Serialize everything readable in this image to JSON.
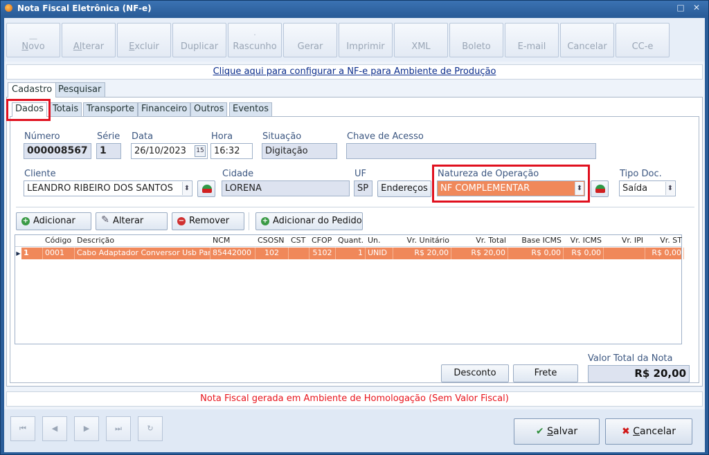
{
  "window": {
    "title": "Nota Fiscal Eletrônica (NF-e)",
    "controls": "□ ✕"
  },
  "toolbar": [
    {
      "first": "N",
      "rest": "ovo",
      "glyph": "__"
    },
    {
      "first": "Al",
      "rest": "terar",
      "glyph": ""
    },
    {
      "first": "E",
      "rest": "xcluir",
      "glyph": ""
    },
    {
      "first": "",
      "rest": "Duplicar",
      "glyph": ""
    },
    {
      "first": "",
      "rest": "Rascunho",
      "glyph": "·"
    },
    {
      "first": "",
      "rest": "Gerar",
      "glyph": ""
    },
    {
      "first": "",
      "rest": "Imprimir",
      "glyph": ""
    },
    {
      "first": "",
      "rest": "XML",
      "glyph": ""
    },
    {
      "first": "",
      "rest": "Boleto",
      "glyph": ""
    },
    {
      "first": "",
      "rest": "E-mail",
      "glyph": ""
    },
    {
      "first": "",
      "rest": "Cancelar",
      "glyph": ""
    },
    {
      "first": "",
      "rest": "CC-e",
      "glyph": ""
    }
  ],
  "prod_link": "Clique aqui para configurar a NF-e para Ambiente de Produção",
  "main_tabs": [
    "Cadastro",
    "Pesquisar"
  ],
  "sub_tabs": [
    "Dados",
    "Totais",
    "Transporte",
    "Financeiro",
    "Outros",
    "Eventos"
  ],
  "labels": {
    "numero": "Número",
    "serie": "Série",
    "data": "Data",
    "hora": "Hora",
    "situacao": "Situação",
    "chave": "Chave de Acesso",
    "cliente": "Cliente",
    "cidade": "Cidade",
    "uf": "UF",
    "natureza": "Natureza de Operação",
    "tipo": "Tipo Doc."
  },
  "values": {
    "numero": "000008567",
    "serie": "1",
    "data": "26/10/2023",
    "hora": "16:32",
    "situacao": "Digitação",
    "chave": "",
    "cliente": "LEANDRO RIBEIRO DOS SANTOS",
    "cidade": "LORENA",
    "uf": "SP",
    "natureza": "NF COMPLEMENTAR",
    "tipo": "Saída"
  },
  "calendar_glyph": "15",
  "spin_glyph": "⬍",
  "buttons": {
    "enderecos": "Endereços",
    "adicionar": "Adicionar",
    "alterar": "Alterar",
    "remover": "Remover",
    "adicionar_pedido": "Adicionar do Pedido",
    "desconto": "Desconto",
    "frete": "Frete"
  },
  "grid": {
    "headers": [
      "Código",
      "Descrição",
      "NCM",
      "CSOSN",
      "CST",
      "CFOP",
      "Quant.",
      "Un.",
      "Vr. Unitário",
      "Vr. Total",
      "Base ICMS",
      "Vr. ICMS",
      "Vr. IPI",
      "Vr. ST"
    ],
    "row": {
      "index": "1",
      "codigo": "0001",
      "descricao": "Cabo Adaptador Conversor Usb Para",
      "ncm": "85442000",
      "csosn": "102",
      "cst": "",
      "cfop": "5102",
      "quant": "1",
      "un": "UNID",
      "vr_unit": "R$ 20,00",
      "vr_total": "R$ 20,00",
      "base_icms": "R$ 0,00",
      "vr_icms": "R$ 0,00",
      "vr_ipi": "",
      "vr_st": "R$ 0,00"
    }
  },
  "valor_total": {
    "label": "Valor Total da Nota",
    "value": "R$ 20,00"
  },
  "homolog_msg": "Nota Fiscal gerada em Ambiente de Homologação (Sem Valor Fiscal)",
  "footer": {
    "nav": [
      "⏮",
      "◀",
      "▶",
      "⏭",
      "↻"
    ],
    "salvar_first": "S",
    "salvar_rest": "alvar",
    "cancelar_first": "C",
    "cancelar_rest": "ancelar"
  },
  "colors": {
    "accent_orange": "#f0885a",
    "red_highlight": "#e0101e",
    "titlebar": "#2a5d99"
  }
}
